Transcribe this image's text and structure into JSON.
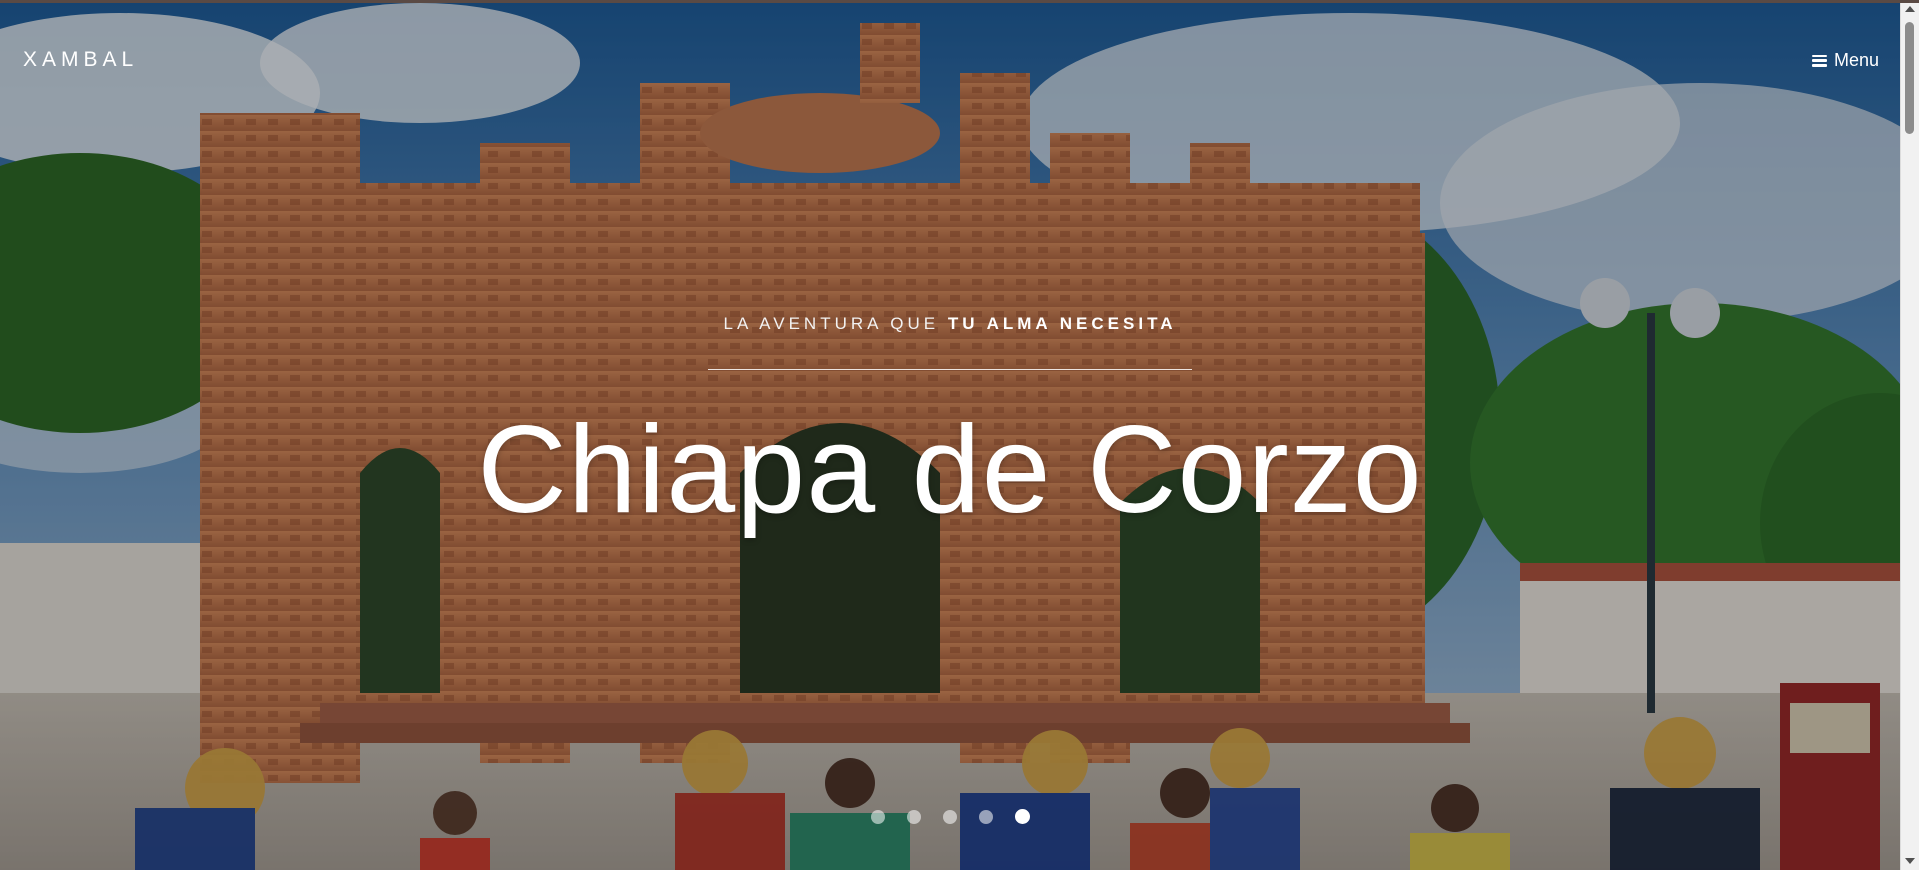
{
  "brand": {
    "name": "XAMBAL"
  },
  "nav": {
    "menu_label": "Menu",
    "menu_icon": "hamburger-icon"
  },
  "hero": {
    "eyebrow_normal": "LA AVENTURA QUE ",
    "eyebrow_bold": "TU ALMA NECESITA",
    "title": "Chiapa de Corzo",
    "slides_count": 5,
    "active_slide": 5
  },
  "colors": {
    "sky": "#2f6fae",
    "brick": "#c0764e",
    "foliage": "#2d6b2c",
    "text": "#ffffff"
  }
}
